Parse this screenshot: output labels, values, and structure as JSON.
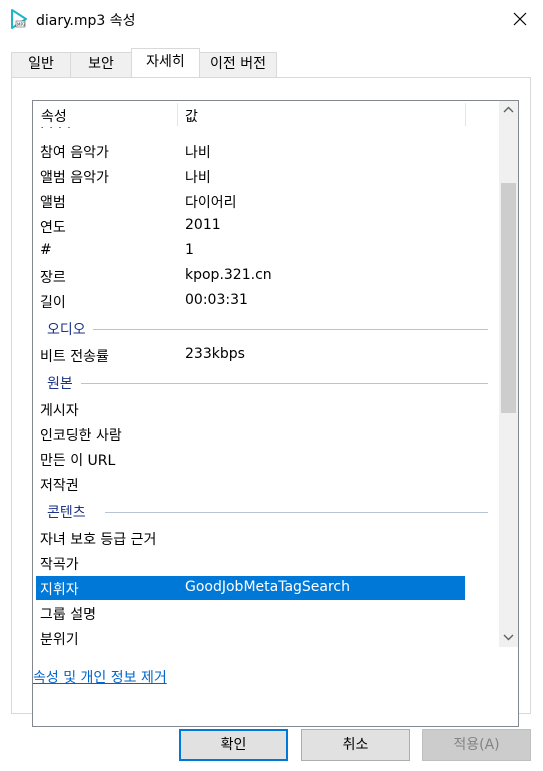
{
  "window": {
    "title": "diary.mp3 속성",
    "icon": "media-file-icon",
    "close_icon": "close-icon"
  },
  "tabs": [
    {
      "label": "일반",
      "active": false
    },
    {
      "label": "보안",
      "active": false
    },
    {
      "label": "자세히",
      "active": true
    },
    {
      "label": "이전 버전",
      "active": false
    }
  ],
  "list": {
    "headers": [
      "속성",
      "값"
    ],
    "partial_top_label": "· · · ·",
    "rows_a": [
      {
        "key": "참여 음악가",
        "value": "나비"
      },
      {
        "key": "앨범 음악가",
        "value": "나비"
      },
      {
        "key": "앨범",
        "value": "다이어리"
      },
      {
        "key": "연도",
        "value": "2011"
      },
      {
        "key": "#",
        "value": "1"
      },
      {
        "key": "장르",
        "value": "kpop.321.cn"
      },
      {
        "key": "길이",
        "value": "00:03:31"
      }
    ],
    "group_audio": "오디오",
    "rows_b": [
      {
        "key": "비트 전송률",
        "value": "233kbps"
      }
    ],
    "group_origin": "원본",
    "rows_c": [
      {
        "key": "게시자",
        "value": ""
      },
      {
        "key": "인코딩한 사람",
        "value": ""
      },
      {
        "key": "만든 이 URL",
        "value": ""
      },
      {
        "key": "저작권",
        "value": ""
      }
    ],
    "group_content": "콘텐츠",
    "rows_d": [
      {
        "key": "자녀 보호 등급 근거",
        "value": ""
      },
      {
        "key": "작곡가",
        "value": ""
      },
      {
        "key": "지휘자",
        "value": "GoodJobMetaTagSearch",
        "selected": true
      },
      {
        "key": "그룹 설명",
        "value": ""
      },
      {
        "key": "분위기",
        "value": ""
      }
    ]
  },
  "link_text": "속성 및 개인 정보 제거",
  "buttons": {
    "ok": "확인",
    "cancel": "취소",
    "apply": "적용(A)"
  },
  "colors": {
    "selection": "#0078d7",
    "group_text": "#1e3287",
    "link": "#0066cc",
    "app_icon": "#1fb5c9"
  }
}
